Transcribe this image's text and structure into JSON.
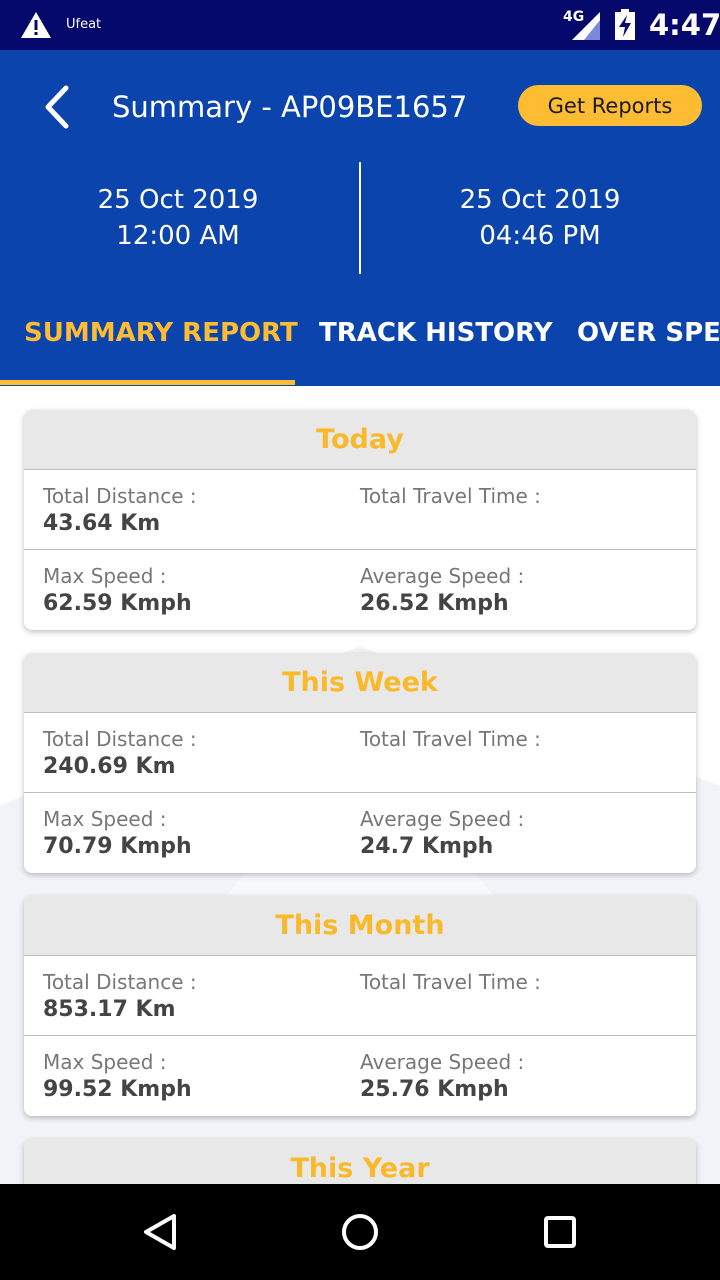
{
  "status_bar": {
    "carrier": "Ufeat",
    "network": "4G",
    "time": "4:47",
    "icons": [
      "warning-icon",
      "signal-icon",
      "battery-charging-icon"
    ]
  },
  "header": {
    "title": "Summary - AP09BE1657",
    "reports_button": "Get Reports",
    "from_date": "25 Oct 2019",
    "from_time": "12:00 AM",
    "to_date": "25 Oct 2019",
    "to_time": "04:46 PM"
  },
  "tabs": [
    {
      "label": "SUMMARY REPORT",
      "active": true
    },
    {
      "label": "TRACK HISTORY",
      "active": false
    },
    {
      "label": "OVER SPEE",
      "active": false
    }
  ],
  "colors": {
    "primary": "#0b44ad",
    "status_bar": "#04096b",
    "accent": "#fdbc31"
  },
  "cards": [
    {
      "title": "Today",
      "total_distance_label": "Total Distance :",
      "total_distance": "43.64 Km",
      "total_travel_time_label": "Total Travel Time :",
      "total_travel_time": "",
      "max_speed_label": "Max Speed :",
      "max_speed": "62.59 Kmph",
      "avg_speed_label": "Average Speed :",
      "avg_speed": "26.52 Kmph"
    },
    {
      "title": "This Week",
      "total_distance_label": "Total Distance :",
      "total_distance": "240.69 Km",
      "total_travel_time_label": "Total Travel Time :",
      "total_travel_time": "",
      "max_speed_label": "Max Speed :",
      "max_speed": "70.79 Kmph",
      "avg_speed_label": "Average Speed :",
      "avg_speed": "24.7 Kmph"
    },
    {
      "title": "This Month",
      "total_distance_label": "Total Distance :",
      "total_distance": "853.17 Km",
      "total_travel_time_label": "Total Travel Time :",
      "total_travel_time": "",
      "max_speed_label": "Max Speed :",
      "max_speed": "99.52 Kmph",
      "avg_speed_label": "Average Speed :",
      "avg_speed": "25.76 Kmph"
    },
    {
      "title": "This Year"
    }
  ],
  "nav": {
    "icons": [
      "nav-back-icon",
      "nav-home-icon",
      "nav-recent-icon"
    ]
  }
}
